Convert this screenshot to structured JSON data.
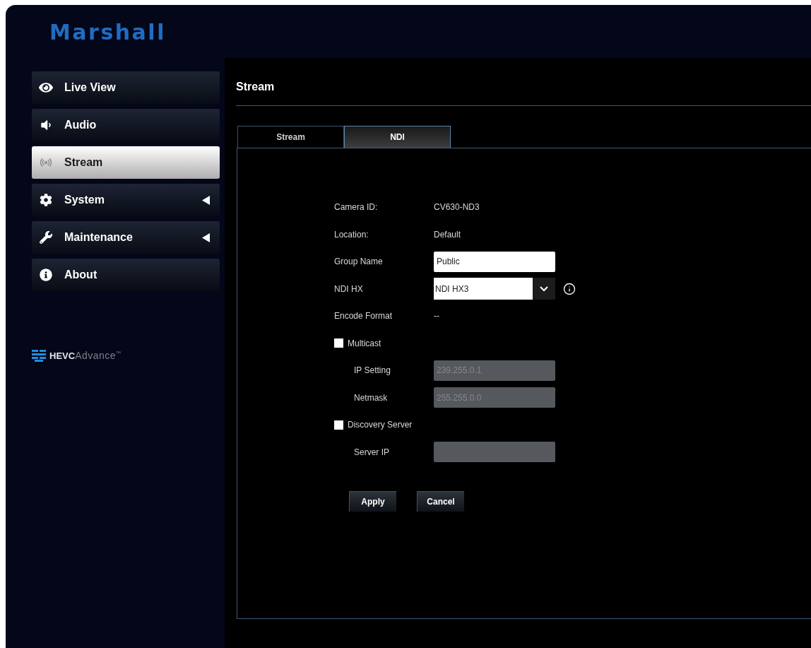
{
  "header": {
    "logo": "Marshall"
  },
  "sidebar": {
    "items": [
      {
        "label": "Live View",
        "selected": false,
        "has_submenu": false
      },
      {
        "label": "Audio",
        "selected": false,
        "has_submenu": false
      },
      {
        "label": "Stream",
        "selected": true,
        "has_submenu": false
      },
      {
        "label": "System",
        "selected": false,
        "has_submenu": true
      },
      {
        "label": "Maintenance",
        "selected": false,
        "has_submenu": true
      },
      {
        "label": "About",
        "selected": false,
        "has_submenu": false
      }
    ],
    "footer_logo": {
      "name": "HEVC",
      "suffix": "Advance",
      "mark": "™"
    }
  },
  "page": {
    "title": "Stream"
  },
  "tabs": [
    {
      "label": "Stream",
      "selected": false
    },
    {
      "label": "NDI",
      "selected": true
    }
  ],
  "form": {
    "rows": [
      {
        "kind": "text",
        "label": "Camera ID:",
        "value": "CV630-ND3"
      },
      {
        "kind": "text",
        "label": "Location:",
        "value": "Default"
      },
      {
        "kind": "input",
        "label": "Group Name",
        "value": "Public",
        "disabled": false
      },
      {
        "kind": "select",
        "label": "NDI HX",
        "value": "NDI HX3",
        "help": true
      },
      {
        "kind": "text",
        "label": "Encode Format",
        "value": "--"
      },
      {
        "kind": "checkbox",
        "label": "Multicast",
        "checked": false,
        "children": [
          {
            "kind": "input",
            "label": "IP Setting",
            "value": "239.255.0.1",
            "disabled": true
          },
          {
            "kind": "input",
            "label": "Netmask",
            "value": "255.255.0.0",
            "disabled": true
          }
        ]
      },
      {
        "kind": "checkbox",
        "label": "Discovery Server",
        "checked": false,
        "children": [
          {
            "kind": "input",
            "label": "Server IP",
            "disabled": true
          }
        ]
      }
    ]
  },
  "buttons": [
    "Apply",
    "Cancel"
  ]
}
